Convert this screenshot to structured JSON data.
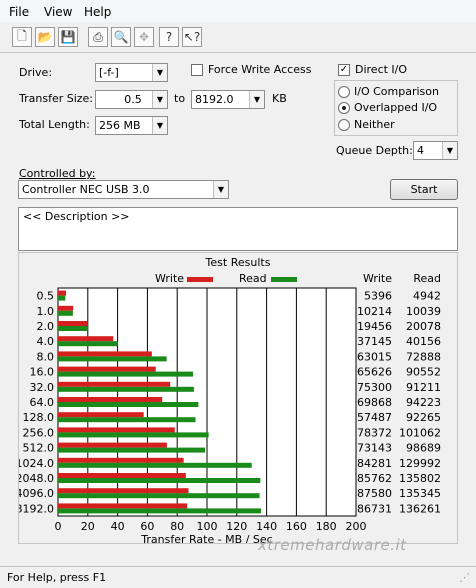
{
  "menu": [
    "File",
    "View",
    "Help"
  ],
  "toolbar": {
    "icons": [
      "new-icon",
      "open-icon",
      "save-icon",
      "print-icon",
      "print-preview-icon",
      "move-icon",
      "help-icon",
      "context-help-icon"
    ]
  },
  "form": {
    "drive_label": "Drive:",
    "drive_value": "[-f-]",
    "transfer_size_label": "Transfer Size:",
    "transfer_from": "0.5",
    "to_label": "to",
    "transfer_to": "8192.0",
    "kb_label": "KB",
    "total_length_label": "Total Length:",
    "total_length_value": "256 MB",
    "force_write_label": "Force Write Access",
    "force_write_checked": false,
    "direct_io_label": "Direct I/O",
    "direct_io_checked": true,
    "radio_options": [
      "I/O Comparison",
      "Overlapped I/O",
      "Neither"
    ],
    "radio_selected": "Overlapped I/O",
    "queue_depth_label": "Queue Depth:",
    "queue_depth_value": "4",
    "controlled_by_label": "Controlled by:",
    "controlled_by_value": "Controller NEC USB 3.0",
    "start_label": "Start",
    "description": "<< Description >>"
  },
  "results": {
    "title": "Test Results",
    "legend_write": "Write",
    "legend_read": "Read",
    "col_write": "Write",
    "col_read": "Read",
    "write_color": "#d62020",
    "read_color": "#1a8a1a"
  },
  "chart_data": {
    "type": "bar",
    "orientation": "horizontal",
    "title": "Test Results",
    "xlabel": "Transfer Rate - MB / Sec",
    "xlim": [
      0,
      200
    ],
    "xticks": [
      0,
      20,
      40,
      60,
      80,
      100,
      120,
      140,
      160,
      180,
      200
    ],
    "categories": [
      "0.5",
      "1.0",
      "2.0",
      "4.0",
      "8.0",
      "16.0",
      "32.0",
      "64.0",
      "128.0",
      "256.0",
      "512.0",
      "1024.0",
      "2048.0",
      "4096.0",
      "8192.0"
    ],
    "series": [
      {
        "name": "Write",
        "values": [
          5.4,
          10.2,
          19.5,
          37.1,
          63.0,
          65.6,
          75.3,
          69.9,
          57.5,
          78.4,
          73.1,
          84.3,
          85.8,
          87.6,
          86.7
        ]
      },
      {
        "name": "Read",
        "values": [
          4.9,
          10.0,
          20.1,
          40.2,
          72.9,
          90.6,
          91.2,
          94.2,
          92.3,
          101.1,
          98.7,
          130.0,
          135.8,
          135.3,
          136.3
        ]
      }
    ],
    "write_table": [
      "5396",
      "10214",
      "19456",
      "37145",
      "63015",
      "65626",
      "75300",
      "69868",
      "57487",
      "78372",
      "73143",
      "84281",
      "85762",
      "87580",
      "86731"
    ],
    "read_table": [
      "4942",
      "10039",
      "20078",
      "40156",
      "72888",
      "90552",
      "91211",
      "94223",
      "92265",
      "101062",
      "98689",
      "129992",
      "135802",
      "135345",
      "136261"
    ],
    "grid": true,
    "legend": "top"
  },
  "status": {
    "text": "For Help, press F1"
  },
  "watermark": "xtremehardware.it"
}
